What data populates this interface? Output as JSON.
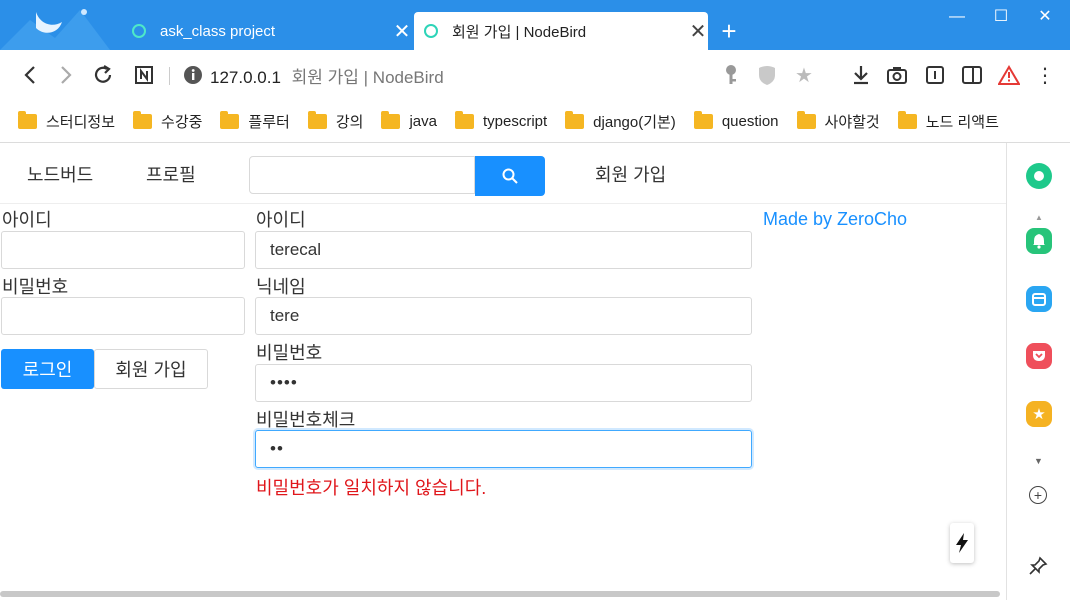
{
  "browser": {
    "tabs": [
      {
        "title": "ask_class project"
      },
      {
        "title": "회원 가입 | NodeBird"
      }
    ],
    "url": {
      "host": "127.0.0.1",
      "title": "회원 가입 | NodeBird"
    },
    "bookmarks": [
      "스터디정보",
      "수강중",
      "플루터",
      "강의",
      "java",
      "typescript",
      "django(기본)",
      "question",
      "사야할것",
      "노드 리액트"
    ]
  },
  "nav": {
    "brand": "노드버드",
    "profile": "프로필",
    "signup": "회원 가입"
  },
  "login_form": {
    "id_label": "아이디",
    "id_value": "",
    "password_label": "비밀번호",
    "password_value": "",
    "login_button": "로그인",
    "signup_button": "회원 가입"
  },
  "signup_form": {
    "id_label": "아이디",
    "id_value": "terecal",
    "nickname_label": "닉네임",
    "nickname_value": "tere",
    "password_label": "비밀번호",
    "password_value": "••••",
    "password_check_label": "비밀번호체크",
    "password_check_value": "••",
    "error_message": "비밀번호가 일치하지 않습니다."
  },
  "footer_link": "Made by ZeroCho",
  "colors": {
    "primary": "#1890ff",
    "error": "#e0161b",
    "titlebar": "#2b8fe8"
  }
}
